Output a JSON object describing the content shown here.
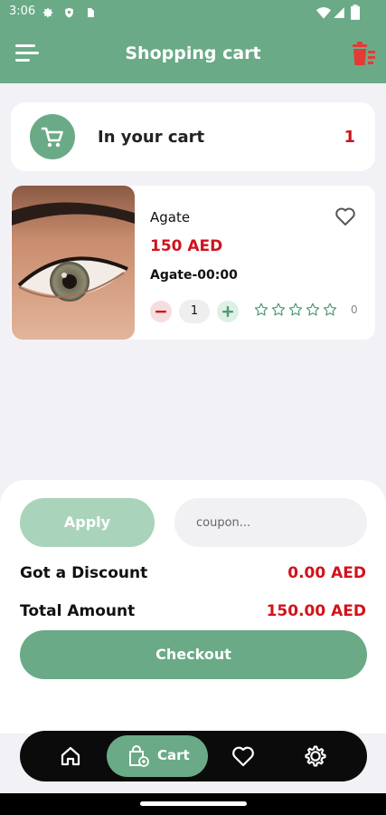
{
  "status_bar": {
    "time": "3:06",
    "icons": [
      "gear-icon",
      "shield-icon",
      "sim-card-icon",
      "wifi-icon",
      "signal-icon",
      "battery-icon"
    ]
  },
  "app_bar": {
    "title": "Shopping cart",
    "menu_icon": "menu-icon",
    "action_icon": "trash-icon",
    "color": "#6aaa87",
    "action_color": "#e53935"
  },
  "cart_summary": {
    "label": "In your cart",
    "count": "1",
    "icon": "cart-icon"
  },
  "items": [
    {
      "name": "Agate",
      "price": "150 AED",
      "variant": "Agate-00:00",
      "quantity": "1",
      "rating_count": "0",
      "rating": 0,
      "image_icon": "eye-lens-photo"
    }
  ],
  "coupon": {
    "apply_label": "Apply",
    "placeholder": "coupon..."
  },
  "totals": {
    "discount_label": "Got a Discount",
    "discount_value": "0.00 AED",
    "total_label": "Total Amount",
    "total_value": "150.00 AED"
  },
  "checkout_label": "Checkout",
  "bottom_nav": {
    "items": [
      {
        "name": "home",
        "icon": "home-icon"
      },
      {
        "name": "cart",
        "label": "Cart",
        "icon": "cart-bag-icon",
        "active": true
      },
      {
        "name": "favorites",
        "icon": "heart-icon"
      },
      {
        "name": "settings",
        "icon": "gear-icon"
      }
    ]
  },
  "colors": {
    "accent": "#6aaa87",
    "price_red": "#d1121c",
    "background": "#f1f1f6"
  }
}
